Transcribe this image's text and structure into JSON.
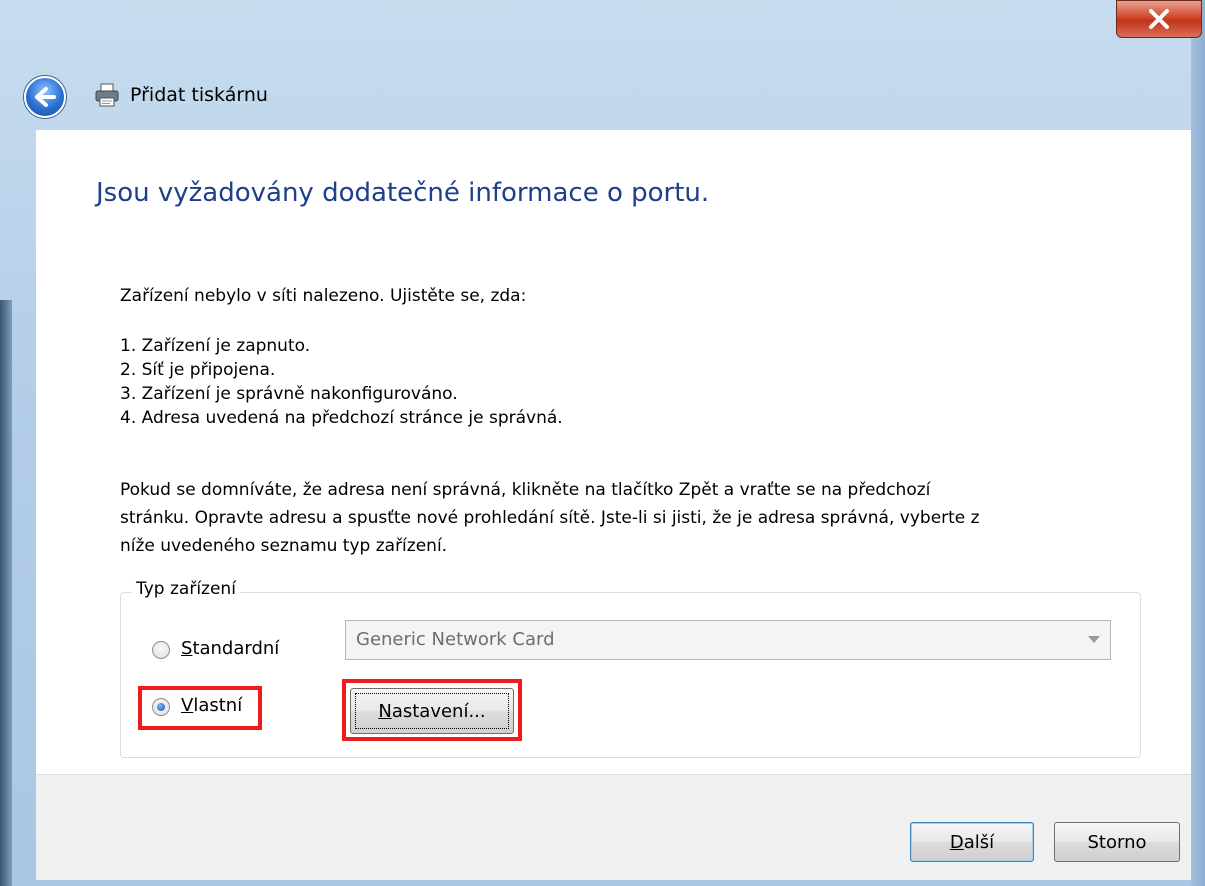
{
  "window": {
    "title": "Přidat tiskárnu",
    "close_glyph": "X"
  },
  "icons": {
    "back": "back-arrow-icon",
    "printer": "printer-icon",
    "close": "close-icon"
  },
  "main": {
    "heading": "Jsou vyžadovány dodatečné informace o portu.",
    "intro": "Zařízení nebylo v síti nalezeno. Ujistěte se, zda:",
    "checklist": [
      "1.  Zařízení je zapnuto.",
      "2.  Síť je připojena.",
      "3.  Zařízení je správně nakonfigurováno.",
      "4.  Adresa uvedená na předchozí stránce je správná."
    ],
    "advice_lines": [
      "Pokud se domníváte, že adresa není správná, klikněte na tlačítko Zpět a vraťte se na předchozí",
      "stránku. Opravte adresu a spusťte nové prohledání sítě. Jste-li si jisti, že je adresa správná, vyberte z",
      "níže uvedeného seznamu typ zařízení."
    ]
  },
  "device_type": {
    "legend": "Typ zařízení",
    "standard_label_accel": "S",
    "standard_label_rest": "tandardní",
    "custom_label_accel": "V",
    "custom_label_rest": "lastní",
    "selected": "Vlastní",
    "standard_combo_value": "Generic Network Card",
    "settings_button_accel": "N",
    "settings_button_rest": "astavení..."
  },
  "footer": {
    "next_accel": "D",
    "next_rest": "alší",
    "cancel_label": "Storno"
  },
  "colors": {
    "heading": "#1e3f8c",
    "highlight": "#ee1c1c"
  }
}
